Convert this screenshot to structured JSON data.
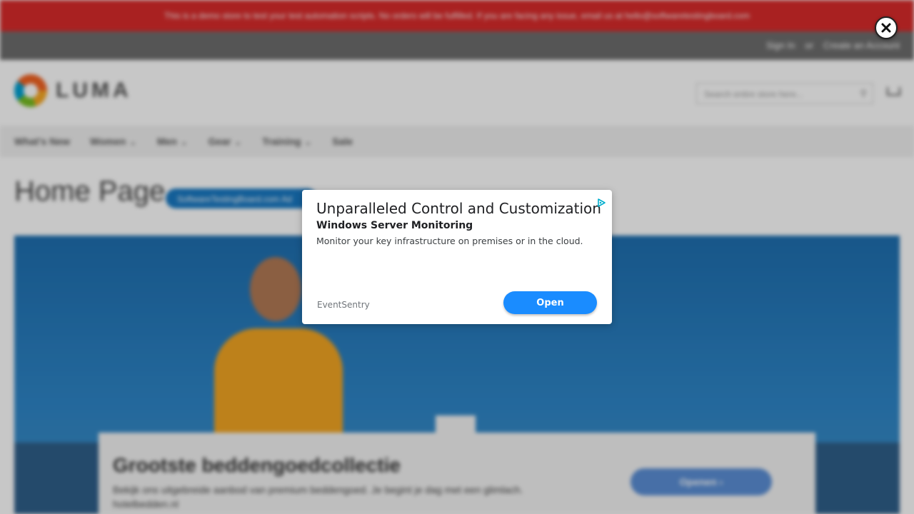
{
  "background_page": {
    "demo_banner": "This is a demo store to test your test automation scripts. No orders will be fulfilled. If you are facing any issue, email us at hello@softwaretestingboard.com",
    "top_links": [
      "Sign In",
      "or",
      "Create an Account"
    ],
    "logo_text": "LUMA",
    "search_placeholder": "Search entire store here...",
    "nav_items": [
      "What's New",
      "Women",
      "Men",
      "Gear",
      "Training",
      "Sale"
    ],
    "page_title": "Home Page",
    "title_badge": "SoftwareTestingBoard.com Ad",
    "bottom_ad": {
      "title": "Grootste beddengoedcollectie",
      "text": "Bekijk ons uitgebreide aanbod van premium beddengoed. Je begint je dag met een glimlach. hotelbedden.nl",
      "button": "Openen ›"
    }
  },
  "ad_modal": {
    "title": "Unparalleled Control and Customization",
    "subtitle": "Windows Server Monitoring",
    "description": "Monitor your key infrastructure on premises or in the cloud.",
    "advertiser": "EventSentry",
    "open_button": "Open",
    "ad_choices_icon": "ad-choices-icon",
    "accent_color": "#1a8cff"
  },
  "close_icon": "close-icon"
}
